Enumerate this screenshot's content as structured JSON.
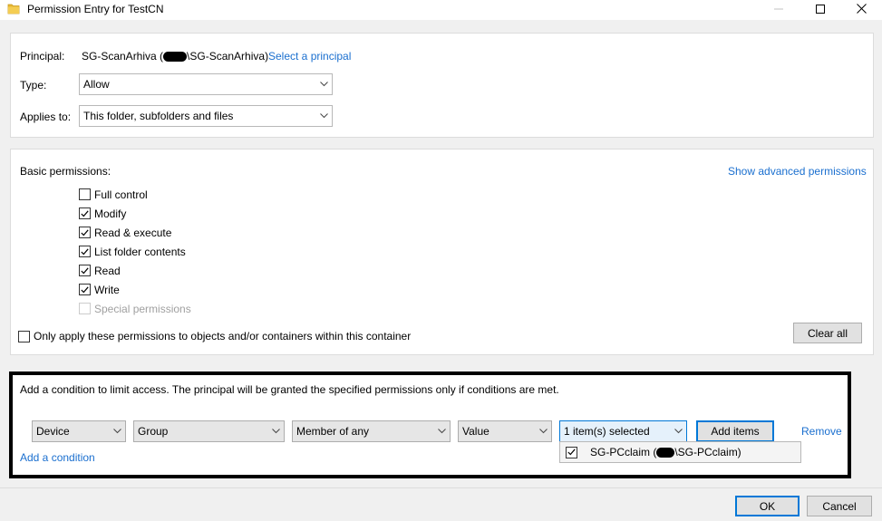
{
  "window": {
    "title": "Permission Entry for TestCN"
  },
  "principal": {
    "label": "Principal:",
    "name_before": "SG-ScanArhiva (",
    "name_after": "\\SG-ScanArhiva)",
    "select_link": "Select a principal"
  },
  "type": {
    "label": "Type:",
    "value": "Allow"
  },
  "applies_to": {
    "label": "Applies to:",
    "value": "This folder, subfolders and files"
  },
  "permissions": {
    "heading": "Basic permissions:",
    "advanced_link": "Show advanced permissions",
    "items": [
      {
        "label": "Full control",
        "checked": false
      },
      {
        "label": "Modify",
        "checked": true
      },
      {
        "label": "Read & execute",
        "checked": true
      },
      {
        "label": "List folder contents",
        "checked": true
      },
      {
        "label": "Read",
        "checked": true
      },
      {
        "label": "Write",
        "checked": true
      },
      {
        "label": "Special permissions",
        "checked": false,
        "disabled": true
      }
    ],
    "only_apply_label": "Only apply these permissions to objects and/or containers within this container",
    "clear_all": "Clear all"
  },
  "condition": {
    "description": "Add a condition to limit access. The principal will be granted the specified permissions only if conditions are met.",
    "attribute": "Device",
    "group": "Group",
    "operator": "Member of any",
    "value_type": "Value",
    "selection": "1 item(s) selected",
    "add_items": "Add items",
    "remove": "Remove",
    "add_condition": "Add a condition",
    "dropdown_item_before": "SG-PCclaim (",
    "dropdown_item_after": "\\SG-PCclaim)"
  },
  "footer": {
    "ok": "OK",
    "cancel": "Cancel"
  }
}
